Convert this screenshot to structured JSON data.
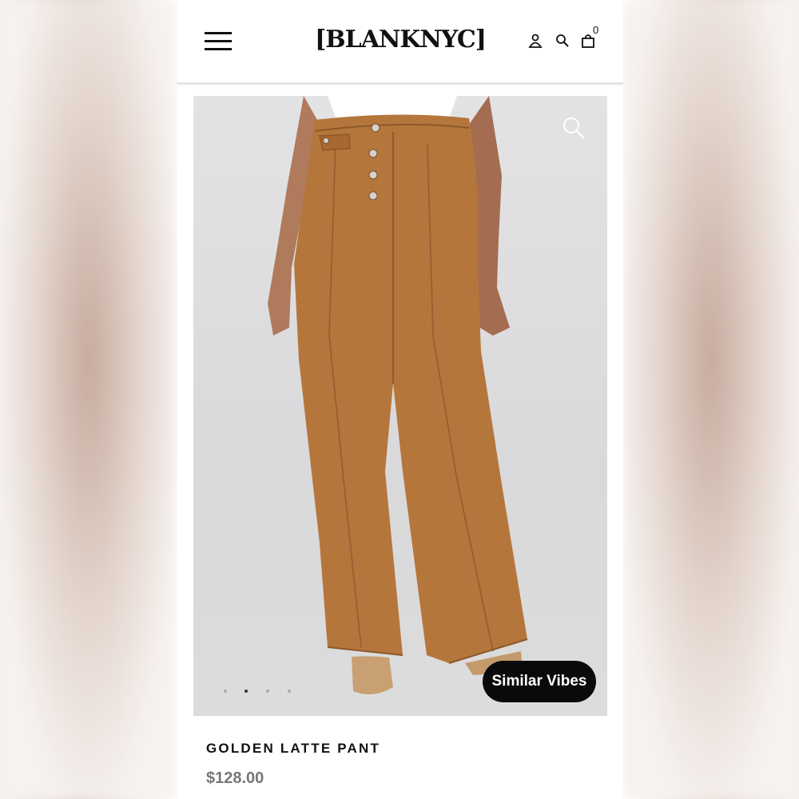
{
  "header": {
    "logo": "[BLANKNYC]",
    "cart_count": "0",
    "icons": [
      "menu-icon",
      "account-icon",
      "search-icon",
      "cart-icon"
    ]
  },
  "product": {
    "name": "GOLDEN LATTE PANT",
    "price": "$128.00",
    "image_description": "brown high-rise wide-leg pant",
    "gallery_dots": 4,
    "active_dot": 2,
    "similar_vibes_label": "Similar Vibes"
  },
  "colors": {
    "pant": "#b5763c",
    "background": "#dcdcdd",
    "button": "#0a0a0a"
  }
}
